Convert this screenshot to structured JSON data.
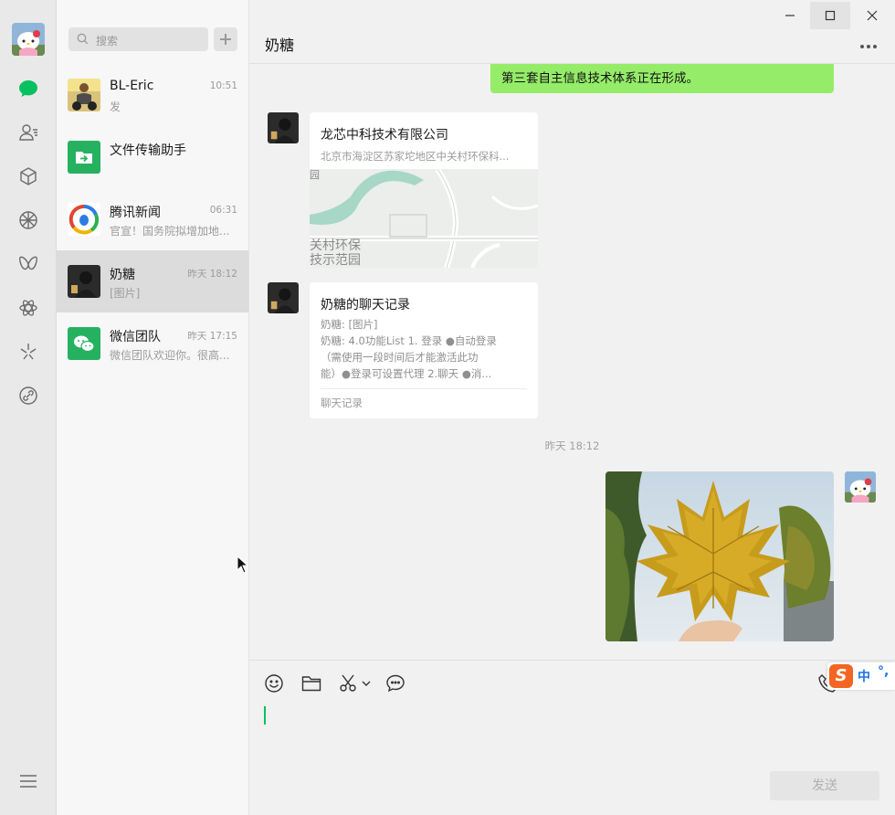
{
  "nav": {
    "items": [
      "chat",
      "contacts",
      "collections",
      "moments",
      "channels",
      "mini-programs",
      "search",
      "links"
    ],
    "menu": "menu"
  },
  "search": {
    "placeholder": "搜索"
  },
  "conversations": [
    {
      "name": "BL-Eric",
      "time": "10:51",
      "preview": "发"
    },
    {
      "name": "文件传输助手",
      "time": "",
      "preview": ""
    },
    {
      "name": "腾讯新闻",
      "time": "06:31",
      "preview": "官宣！国务院拟增加地..."
    },
    {
      "name": "奶糖",
      "time": "昨天 18:12",
      "preview": "[图片]"
    },
    {
      "name": "微信团队",
      "time": "昨天 17:15",
      "preview": "微信团队欢迎你。很高..."
    }
  ],
  "chat": {
    "title": "奶糖",
    "green_bubble_text": "第三套自主信息技术体系正在形成。",
    "location_card": {
      "title": "龙芯中科技术有限公司",
      "address": "北京市海淀区苏家坨地区中关村环保科...",
      "map_label_1": "园",
      "map_label_2": "关村环保",
      "map_label_3": "技示范园"
    },
    "record_card": {
      "title": "奶糖的聊天记录",
      "line1": "奶糖: [图片]",
      "line2": "奶糖: 4.0功能List 1. 登录 ●自动登录",
      "line3": "（需使用一段时间后才能激活此功",
      "line4": "能）●登录可设置代理 2.聊天 ●消...",
      "footer": "聊天记录"
    },
    "timestamp": "昨天 18:12"
  },
  "composer": {
    "send_label": "发送",
    "ime_zh": "中",
    "ime_punc": "°,"
  },
  "colors": {
    "accent": "#07c160",
    "bubble_green": "#95ec69"
  }
}
